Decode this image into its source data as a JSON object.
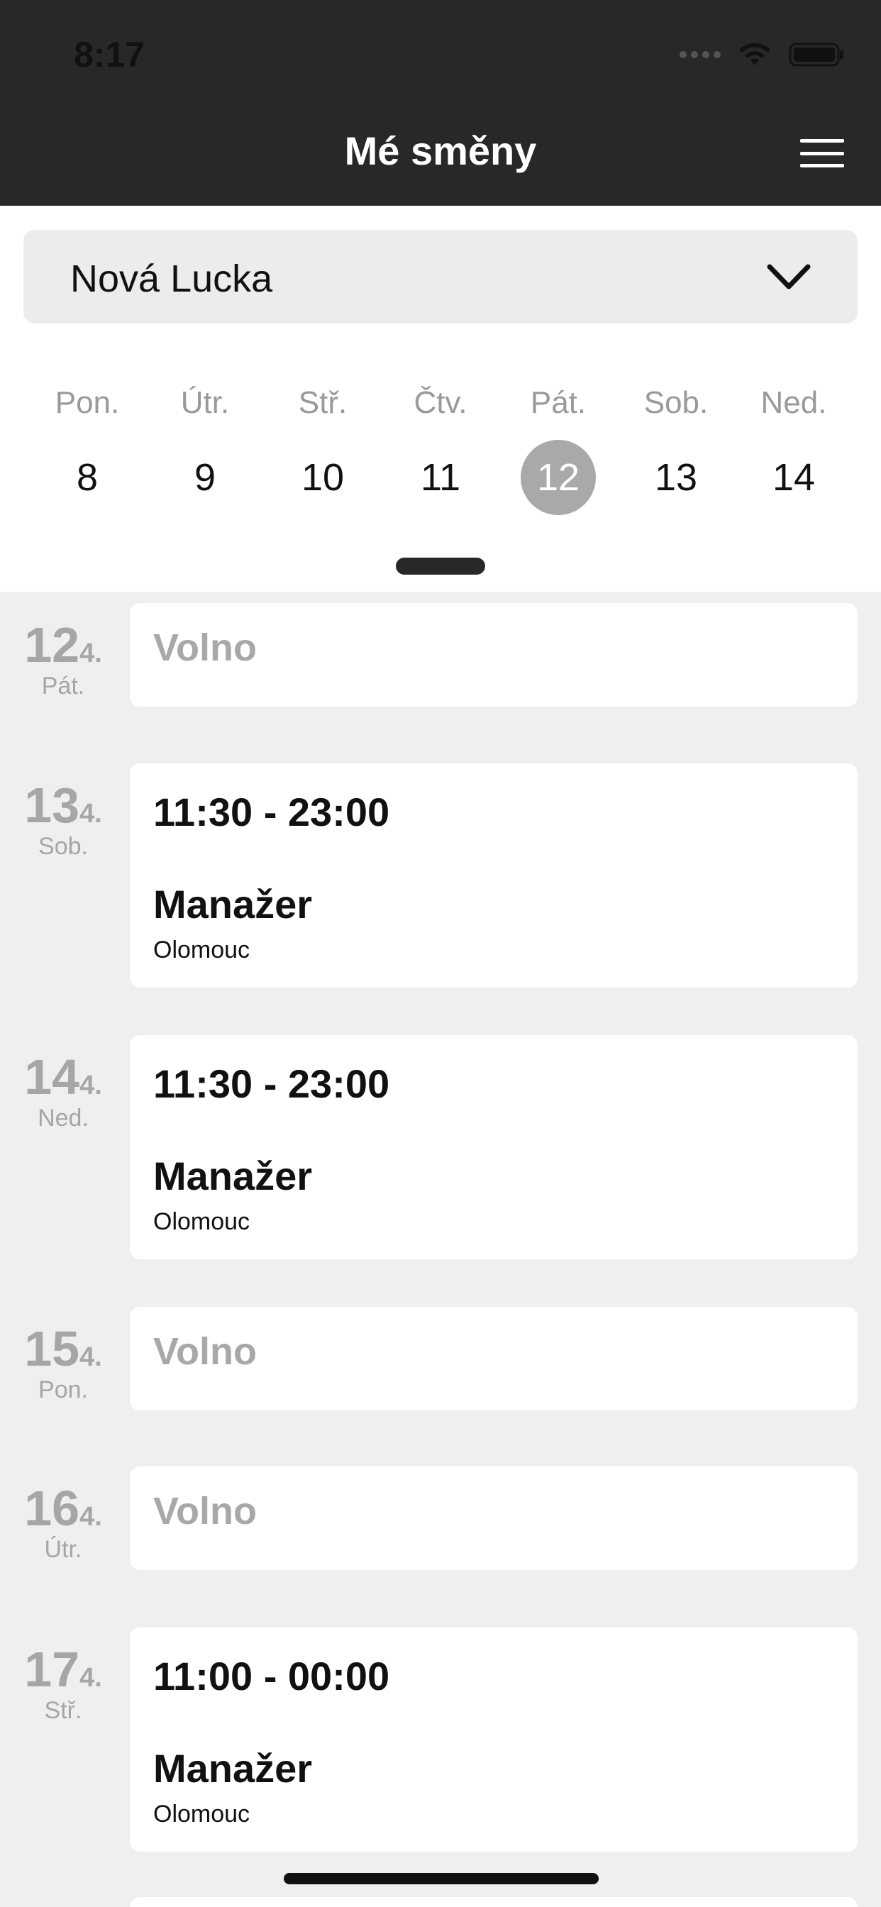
{
  "status_bar": {
    "time": "8:17"
  },
  "header": {
    "title": "Mé směny"
  },
  "selector": {
    "value": "Nová Lucka"
  },
  "week": [
    {
      "name": "Pon.",
      "num": "8"
    },
    {
      "name": "Útr.",
      "num": "9"
    },
    {
      "name": "Stř.",
      "num": "10"
    },
    {
      "name": "Čtv.",
      "num": "11"
    },
    {
      "name": "Pát.",
      "num": "12",
      "selected": true
    },
    {
      "name": "Sob.",
      "num": "13"
    },
    {
      "name": "Ned.",
      "num": "14"
    }
  ],
  "shifts": [
    {
      "day": "12",
      "month": "4.",
      "weekday": "Pát.",
      "type": "free",
      "label": "Volno"
    },
    {
      "day": "13",
      "month": "4.",
      "weekday": "Sob.",
      "type": "shift",
      "time": "11:30 - 23:00",
      "role": "Manažer",
      "place": "Olomouc"
    },
    {
      "day": "14",
      "month": "4.",
      "weekday": "Ned.",
      "type": "shift",
      "time": "11:30 - 23:00",
      "role": "Manažer",
      "place": "Olomouc"
    },
    {
      "day": "15",
      "month": "4.",
      "weekday": "Pon.",
      "type": "free",
      "label": "Volno"
    },
    {
      "day": "16",
      "month": "4.",
      "weekday": "Útr.",
      "type": "free",
      "label": "Volno"
    },
    {
      "day": "17",
      "month": "4.",
      "weekday": "Stř.",
      "type": "shift",
      "time": "11:00 - 00:00",
      "role": "Manažer",
      "place": "Olomouc"
    }
  ]
}
